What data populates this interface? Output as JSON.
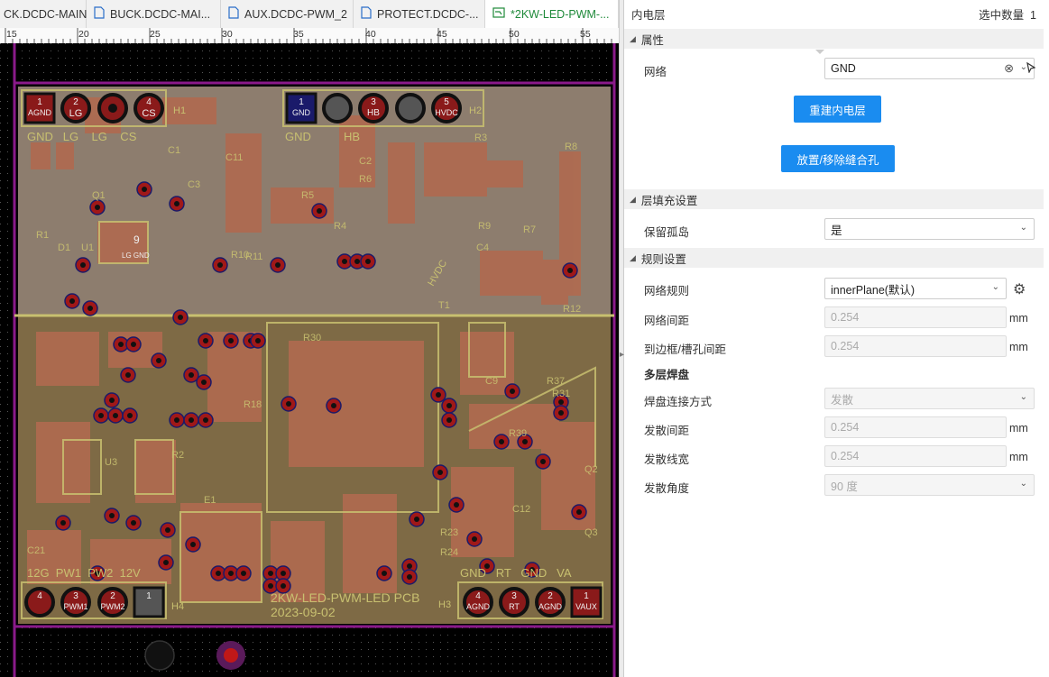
{
  "tabs": [
    {
      "label": "CK.DCDC-MAIN",
      "icon": "schematic-icon",
      "active": false
    },
    {
      "label": "BUCK.DCDC-MAI...",
      "icon": "document-icon",
      "active": false
    },
    {
      "label": "AUX.DCDC-PWM_2",
      "icon": "document-icon",
      "active": false
    },
    {
      "label": "PROTECT.DCDC-...",
      "icon": "document-icon",
      "active": false
    },
    {
      "label": "*2KW-LED-PWM-...",
      "icon": "pcb-icon",
      "active": true
    }
  ],
  "ruler": {
    "ticks": [
      "15",
      "20",
      "25",
      "30",
      "35",
      "40",
      "45",
      "50",
      "55"
    ]
  },
  "pcb": {
    "top_connectors": [
      {
        "num": "1",
        "name": "AGND"
      },
      {
        "num": "2",
        "name": "LG"
      },
      {
        "num": "3",
        "name": ""
      },
      {
        "num": "4",
        "name": "CS"
      }
    ],
    "top_connectors2": [
      {
        "num": "1",
        "name": "GND"
      },
      {
        "num": "2",
        "name": ""
      },
      {
        "num": "3",
        "name": "HB"
      },
      {
        "num": "4",
        "name": ""
      },
      {
        "num": "5",
        "name": "HVDC"
      }
    ],
    "bottom_left_connectors": [
      {
        "num": "4",
        "name": ""
      },
      {
        "num": "3",
        "name": "PWM1"
      },
      {
        "num": "2",
        "name": "PWM2"
      },
      {
        "num": "1",
        "name": ""
      }
    ],
    "bottom_right_connectors": [
      {
        "num": "4",
        "name": "AGND"
      },
      {
        "num": "3",
        "name": "RT"
      },
      {
        "num": "2",
        "name": "AGND"
      },
      {
        "num": "1",
        "name": "VAUX"
      }
    ],
    "silk": {
      "h1": "H1",
      "h2": "H2",
      "h3": "H3",
      "h4": "H4",
      "top_labels": "GND   LG    LG    CS",
      "top_labels2": "GND          HB",
      "bottom_labels": "12G  PW1  PW2  12V",
      "bottom_labels2": "GND   RT   GND   VA",
      "board_name": "2KW-LED-PWM-LED PCB",
      "board_date": "2023-09-02",
      "u1": "9",
      "u1_sub": "LG GND",
      "refs": [
        "R1",
        "D1",
        "U1",
        "Q1",
        "C3",
        "C1",
        "R10",
        "R5",
        "R6",
        "R3",
        "R8",
        "R7",
        "R9",
        "C4",
        "T1",
        "R12",
        "C2",
        "R4",
        "R11",
        "C9",
        "R37",
        "R31",
        "E1",
        "U3",
        "R18",
        "C21",
        "R23",
        "R24",
        "C12",
        "Q3",
        "Q2",
        "R2",
        "C11",
        "R30",
        "R39"
      ],
      "hvdc": "HVDC"
    }
  },
  "panel": {
    "title": "内电层",
    "selected_label": "选中数量",
    "selected_count": "1",
    "sections": {
      "attributes": "属性",
      "fill": "层填充设置",
      "rules": "规则设置"
    },
    "net_label": "网络",
    "net_value": "GND",
    "rebuild_button": "重建内电层",
    "stitch_button": "放置/移除缝合孔",
    "keep_island_label": "保留孤岛",
    "keep_island_value": "是",
    "net_rule_label": "网络规则",
    "net_rule_value": "innerPlane(默认)",
    "net_spacing_label": "网络间距",
    "net_spacing_value": "0.254",
    "edge_spacing_label": "到边框/槽孔间距",
    "edge_spacing_value": "0.254",
    "unit": "mm",
    "multilayer_pad_label": "多层焊盘",
    "pad_connect_label": "焊盘连接方式",
    "pad_connect_value": "发散",
    "spoke_spacing_label": "发散间距",
    "spoke_spacing_value": "0.254",
    "spoke_width_label": "发散线宽",
    "spoke_width_value": "0.254",
    "spoke_angle_label": "发散角度",
    "spoke_angle_value": "90 度"
  },
  "colors": {
    "accent": "#1a8cf0",
    "board_outline": "#8a1a8a",
    "pad_red": "#a01818",
    "copper": "#b06a4f",
    "silk": "#c8c070"
  }
}
